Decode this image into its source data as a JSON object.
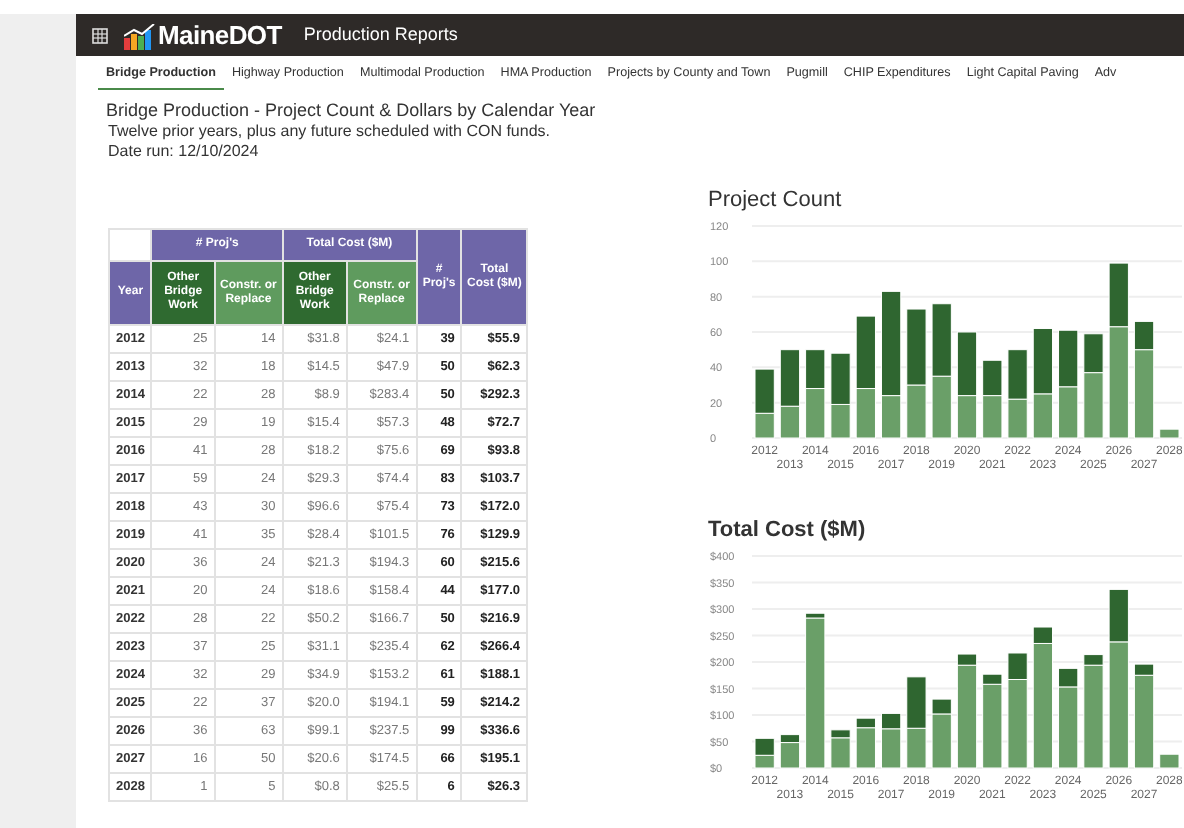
{
  "header": {
    "logo": "MaineDOT",
    "title": "Production Reports"
  },
  "tabs": [
    {
      "label": "Bridge Production",
      "selected": true
    },
    {
      "label": "Highway Production",
      "selected": false
    },
    {
      "label": "Multimodal Production",
      "selected": false
    },
    {
      "label": "HMA Production",
      "selected": false
    },
    {
      "label": "Projects by County and Town",
      "selected": false
    },
    {
      "label": "Pugmill",
      "selected": false
    },
    {
      "label": "CHIP Expenditures",
      "selected": false
    },
    {
      "label": "Light Capital Paving",
      "selected": false
    },
    {
      "label": "Adv",
      "selected": false
    }
  ],
  "report": {
    "title": "Bridge Production - Project Count & Dollars by Calendar Year",
    "subtitle": "Twelve prior years, plus any future scheduled with CON funds.",
    "date_run": "Date run: 12/10/2024"
  },
  "table": {
    "year_header": "Year",
    "groups": [
      {
        "label": "# Proj's",
        "columns": [
          "Other Bridge Work",
          "Constr. or Replace"
        ]
      },
      {
        "label": "Total Cost ($M)",
        "columns": [
          "Other Bridge Work",
          "Constr. or Replace"
        ]
      }
    ],
    "totals": [
      "# Proj's",
      "Total Cost ($M)"
    ],
    "rows": [
      [
        "2012",
        "25",
        "14",
        "$31.8",
        "$24.1",
        "39",
        "$55.9"
      ],
      [
        "2013",
        "32",
        "18",
        "$14.5",
        "$47.9",
        "50",
        "$62.3"
      ],
      [
        "2014",
        "22",
        "28",
        "$8.9",
        "$283.4",
        "50",
        "$292.3"
      ],
      [
        "2015",
        "29",
        "19",
        "$15.4",
        "$57.3",
        "48",
        "$72.7"
      ],
      [
        "2016",
        "41",
        "28",
        "$18.2",
        "$75.6",
        "69",
        "$93.8"
      ],
      [
        "2017",
        "59",
        "24",
        "$29.3",
        "$74.4",
        "83",
        "$103.7"
      ],
      [
        "2018",
        "43",
        "30",
        "$96.6",
        "$75.4",
        "73",
        "$172.0"
      ],
      [
        "2019",
        "41",
        "35",
        "$28.4",
        "$101.5",
        "76",
        "$129.9"
      ],
      [
        "2020",
        "36",
        "24",
        "$21.3",
        "$194.3",
        "60",
        "$215.6"
      ],
      [
        "2021",
        "20",
        "24",
        "$18.6",
        "$158.4",
        "44",
        "$177.0"
      ],
      [
        "2022",
        "28",
        "22",
        "$50.2",
        "$166.7",
        "50",
        "$216.9"
      ],
      [
        "2023",
        "37",
        "25",
        "$31.1",
        "$235.4",
        "62",
        "$266.4"
      ],
      [
        "2024",
        "32",
        "29",
        "$34.9",
        "$153.2",
        "61",
        "$188.1"
      ],
      [
        "2025",
        "22",
        "37",
        "$20.0",
        "$194.1",
        "59",
        "$214.2"
      ],
      [
        "2026",
        "36",
        "63",
        "$99.1",
        "$237.5",
        "99",
        "$336.6"
      ],
      [
        "2027",
        "16",
        "50",
        "$20.6",
        "$174.5",
        "66",
        "$195.1"
      ],
      [
        "2028",
        "1",
        "5",
        "$0.8",
        "$25.5",
        "6",
        "$26.3"
      ]
    ]
  },
  "charts": [
    {
      "chart_data": {
        "type": "bar",
        "title": "Project Count",
        "stacked": true,
        "grid": true,
        "categories": [
          "2012",
          "2013",
          "2014",
          "2015",
          "2016",
          "2017",
          "2018",
          "2019",
          "2020",
          "2021",
          "2022",
          "2023",
          "2024",
          "2025",
          "2026",
          "2027",
          "2028"
        ],
        "ylim": [
          0,
          120
        ],
        "yticks": [
          0,
          20,
          40,
          60,
          80,
          100,
          120
        ],
        "series": [
          {
            "color": "#6a9f68",
            "values": [
              14,
              18,
              28,
              19,
              28,
              24,
              30,
              35,
              24,
              24,
              22,
              25,
              29,
              37,
              63,
              50,
              5
            ]
          },
          {
            "color": "#2f6630",
            "values": [
              25,
              32,
              22,
              29,
              41,
              59,
              43,
              41,
              36,
              20,
              28,
              37,
              32,
              22,
              36,
              16,
              1
            ]
          }
        ]
      }
    },
    {
      "chart_data": {
        "type": "bar",
        "title": "Total Cost ($M)",
        "stacked": true,
        "grid": true,
        "categories": [
          "2012",
          "2013",
          "2014",
          "2015",
          "2016",
          "2017",
          "2018",
          "2019",
          "2020",
          "2021",
          "2022",
          "2023",
          "2024",
          "2025",
          "2026",
          "2027",
          "2028"
        ],
        "ylim": [
          0,
          400
        ],
        "yticks": [
          {
            "value": 0,
            "label": "$0"
          },
          {
            "value": 50,
            "label": "$50"
          },
          {
            "value": 100,
            "label": "$100"
          },
          {
            "value": 150,
            "label": "$150"
          },
          {
            "value": 200,
            "label": "$200"
          },
          {
            "value": 250,
            "label": "$250"
          },
          {
            "value": 300,
            "label": "$300"
          },
          {
            "value": 350,
            "label": "$350"
          },
          {
            "value": 400,
            "label": "$400"
          }
        ],
        "series": [
          {
            "color": "#6a9f68",
            "values": [
              24,
              48,
              283,
              57,
              76,
              74,
              75,
              102,
              194,
              158,
              167,
              235,
              153,
              194,
              238,
              175,
              26
            ]
          },
          {
            "color": "#2f6630",
            "values": [
              32,
              15,
              9,
              15,
              18,
              29,
              97,
              28,
              21,
              19,
              50,
              31,
              35,
              20,
              99,
              21,
              1
            ]
          }
        ]
      }
    }
  ]
}
